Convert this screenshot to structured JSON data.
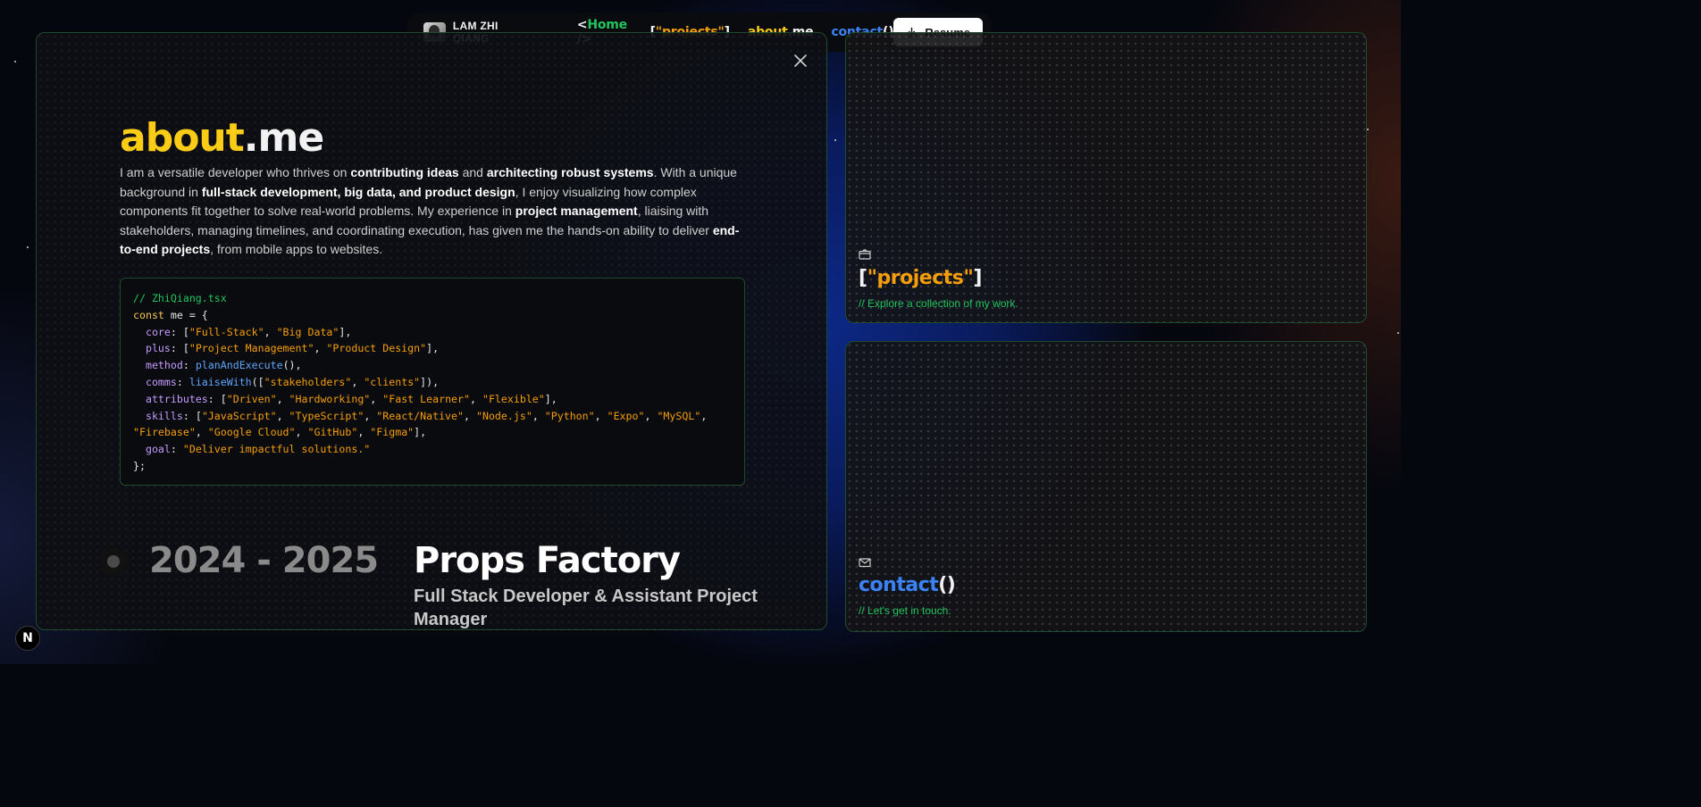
{
  "nav": {
    "brand_name": "LAM ZHI QIANG",
    "home_open": "<",
    "home_label": "Home",
    "home_close": " />",
    "projects_open": "[",
    "projects_label": "\"projects\"",
    "projects_close": "]",
    "about_accent": "about",
    "about_rest": ".me",
    "contact_label": "contact",
    "contact_parens": "()",
    "resume_label": "Resume"
  },
  "about": {
    "title_accent": "about",
    "title_rest": ".me",
    "paragraph": [
      {
        "t": "I am a versatile developer who thrives on ",
        "b": false
      },
      {
        "t": "contributing ideas",
        "b": true
      },
      {
        "t": " and ",
        "b": false
      },
      {
        "t": "architecting robust systems",
        "b": true
      },
      {
        "t": ". With a unique background in ",
        "b": false
      },
      {
        "t": "full-stack development, big data, and product design",
        "b": true
      },
      {
        "t": ", I enjoy visualizing how complex components fit together to solve real-world problems. My experience in ",
        "b": false
      },
      {
        "t": "project management",
        "b": true
      },
      {
        "t": ", liaising with stakeholders, managing timelines, and coordinating execution, has given me the hands-on ability to deliver ",
        "b": false
      },
      {
        "t": "end-to-end projects",
        "b": true
      },
      {
        "t": ", from mobile apps to websites.",
        "b": false
      }
    ]
  },
  "code": {
    "lines": [
      [
        [
          "c-comment",
          "// ZhiQiang.tsx"
        ]
      ],
      [
        [
          "c-kw",
          "const"
        ],
        [
          "",
          " me = {"
        ]
      ],
      [
        [
          "",
          "  "
        ],
        [
          "c-key",
          "core"
        ],
        [
          "",
          ": ["
        ],
        [
          "c-str",
          "\"Full-Stack\""
        ],
        [
          "",
          ", "
        ],
        [
          "c-str",
          "\"Big Data\""
        ],
        [
          "",
          "],"
        ]
      ],
      [
        [
          "",
          "  "
        ],
        [
          "c-key",
          "plus"
        ],
        [
          "",
          ": ["
        ],
        [
          "c-str",
          "\"Project Management\""
        ],
        [
          "",
          ", "
        ],
        [
          "c-str",
          "\"Product Design\""
        ],
        [
          "",
          "],"
        ]
      ],
      [
        [
          "",
          "  "
        ],
        [
          "c-key",
          "method"
        ],
        [
          "",
          ": "
        ],
        [
          "c-fn",
          "planAndExecute"
        ],
        [
          "",
          "(),"
        ]
      ],
      [
        [
          "",
          "  "
        ],
        [
          "c-key",
          "comms"
        ],
        [
          "",
          ": "
        ],
        [
          "c-fn",
          "liaiseWith"
        ],
        [
          "",
          "(["
        ],
        [
          "c-str",
          "\"stakeholders\""
        ],
        [
          "",
          ", "
        ],
        [
          "c-str",
          "\"clients\""
        ],
        [
          "",
          "]),"
        ]
      ],
      [
        [
          "",
          "  "
        ],
        [
          "c-key",
          "attributes"
        ],
        [
          "",
          ": ["
        ],
        [
          "c-str",
          "\"Driven\""
        ],
        [
          "",
          ", "
        ],
        [
          "c-str",
          "\"Hardworking\""
        ],
        [
          "",
          ", "
        ],
        [
          "c-str",
          "\"Fast Learner\""
        ],
        [
          "",
          ", "
        ],
        [
          "c-str",
          "\"Flexible\""
        ],
        [
          "",
          "],"
        ]
      ],
      [
        [
          "",
          "  "
        ],
        [
          "c-key",
          "skills"
        ],
        [
          "",
          ": ["
        ],
        [
          "c-str",
          "\"JavaScript\""
        ],
        [
          "",
          ", "
        ],
        [
          "c-str",
          "\"TypeScript\""
        ],
        [
          "",
          ", "
        ],
        [
          "c-str",
          "\"React/Native\""
        ],
        [
          "",
          ", "
        ],
        [
          "c-str",
          "\"Node.js\""
        ],
        [
          "",
          ", "
        ],
        [
          "c-str",
          "\"Python\""
        ],
        [
          "",
          ", "
        ],
        [
          "c-str",
          "\"Expo\""
        ],
        [
          "",
          ", "
        ],
        [
          "c-str",
          "\"MySQL\""
        ],
        [
          "",
          ","
        ]
      ],
      [
        [
          "c-str",
          "\"Firebase\""
        ],
        [
          "",
          ", "
        ],
        [
          "c-str",
          "\"Google Cloud\""
        ],
        [
          "",
          ", "
        ],
        [
          "c-str",
          "\"GitHub\""
        ],
        [
          "",
          ", "
        ],
        [
          "c-str",
          "\"Figma\""
        ],
        [
          "",
          "],"
        ]
      ],
      [
        [
          "",
          "  "
        ],
        [
          "c-key",
          "goal"
        ],
        [
          "",
          ": "
        ],
        [
          "c-str",
          "\"Deliver impactful solutions.\""
        ]
      ],
      [
        [
          "",
          "};"
        ]
      ]
    ]
  },
  "timeline": {
    "years": "2024 - 2025",
    "company": "Props Factory",
    "role": "Full Stack Developer & Assistant Project Manager"
  },
  "cards": {
    "projects": {
      "open": "[",
      "label": "\"projects\"",
      "close": "]",
      "subtitle": "// Explore a collection of my work."
    },
    "contact": {
      "label": "contact",
      "parens": "()",
      "subtitle": "// Let's get in touch."
    }
  },
  "badge": {
    "letter": "N"
  },
  "icons": {
    "close": "close-icon",
    "download": "download-icon",
    "projects": "folder-icon",
    "contact": "mail-icon"
  },
  "colors": {
    "green": "#22c55e",
    "orange": "#f59e0b",
    "yellow": "#facc15",
    "blue": "#3b82f6",
    "purple": "#c49bff",
    "border": "#1f4a2e"
  }
}
